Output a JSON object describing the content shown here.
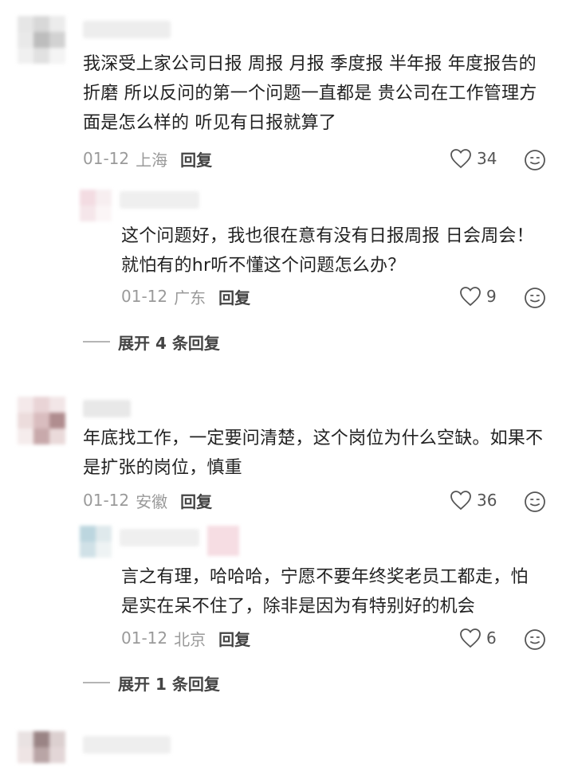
{
  "comments": [
    {
      "text": "我深受上家公司日报 周报 月报 季度报 半年报 年度报告的折磨 所以反问的第一个问题一直都是 贵公司在工作管理方面是怎么样的 听见有日报就算了",
      "date": "01-12",
      "location": "上海",
      "reply_label": "回复",
      "likes": "34",
      "replies": [
        {
          "text": "这个问题好，我也很在意有没有日报周报 日会周会！就怕有的hr听不懂这个问题怎么办？",
          "date": "01-12",
          "location": "广东",
          "reply_label": "回复",
          "likes": "9"
        }
      ],
      "expand_label": "展开 4 条回复"
    },
    {
      "text": "年底找工作，一定要问清楚，这个岗位为什么空缺。如果不是扩张的岗位，慎重",
      "date": "01-12",
      "location": "安徽",
      "reply_label": "回复",
      "likes": "36",
      "replies": [
        {
          "text": "言之有理，哈哈哈，宁愿不要年终奖老员工都走，怕是实在呆不住了，除非是因为有特别好的机会",
          "date": "01-12",
          "location": "北京",
          "reply_label": "回复",
          "likes": "6"
        }
      ],
      "expand_label": "展开 1 条回复"
    }
  ],
  "icons": {
    "like": "heart-outline-icon",
    "emoji": "smiley-face-icon"
  }
}
